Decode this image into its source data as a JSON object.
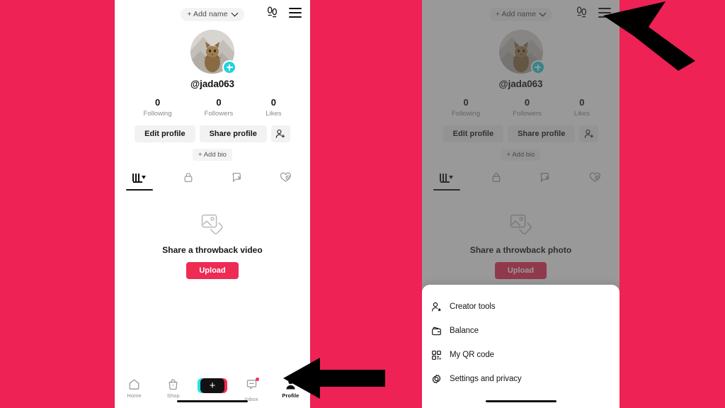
{
  "background_color": "#ee2255",
  "panels": [
    {
      "id": "left",
      "dimmed": false,
      "header": {
        "add_name_label": "+ Add name",
        "chevron_icon": "chevron-down-icon",
        "qa_icon": "footprints-icon",
        "menu_icon": "hamburger-menu-icon"
      },
      "profile": {
        "avatar_icon": "cat-avatar",
        "add_photo_badge": "plus-badge-icon",
        "handle": "@jada063",
        "stats": [
          {
            "value": "0",
            "label": "Following"
          },
          {
            "value": "0",
            "label": "Followers"
          },
          {
            "value": "0",
            "label": "Likes"
          }
        ],
        "edit_profile_label": "Edit profile",
        "share_profile_label": "Share profile",
        "add_friends_icon": "person-add-icon",
        "add_bio_label": "+ Add bio"
      },
      "tabs": [
        {
          "name": "videos",
          "icon": "grid-icon",
          "active": true
        },
        {
          "name": "private",
          "icon": "lock-icon",
          "active": false
        },
        {
          "name": "reposts",
          "icon": "repost-icon",
          "active": false
        },
        {
          "name": "liked",
          "icon": "heart-hidden-icon",
          "active": false
        }
      ],
      "empty_state": {
        "image_icon": "photo-stack-icon",
        "title": "Share a throwback video",
        "upload_label": "Upload",
        "upload_color": "#ee2b55"
      },
      "bottom_nav": [
        {
          "name": "home",
          "icon": "home-icon",
          "label": "Home",
          "active": false
        },
        {
          "name": "shop",
          "icon": "shop-bag-icon",
          "label": "Shop",
          "active": false
        },
        {
          "name": "create",
          "icon": "plus-button-icon",
          "label": "",
          "active": false
        },
        {
          "name": "inbox",
          "icon": "inbox-icon",
          "label": "Inbox",
          "active": false,
          "badge": true
        },
        {
          "name": "profile",
          "icon": "person-icon",
          "label": "Profile",
          "active": true
        }
      ],
      "sheet": null
    },
    {
      "id": "right",
      "dimmed": true,
      "header": {
        "add_name_label": "+ Add name",
        "chevron_icon": "chevron-down-icon",
        "qa_icon": "footprints-icon",
        "menu_icon": "hamburger-menu-icon"
      },
      "profile": {
        "avatar_icon": "cat-avatar",
        "add_photo_badge": "plus-badge-icon",
        "handle": "@jada063",
        "stats": [
          {
            "value": "0",
            "label": "Following"
          },
          {
            "value": "0",
            "label": "Followers"
          },
          {
            "value": "0",
            "label": "Likes"
          }
        ],
        "edit_profile_label": "Edit profile",
        "share_profile_label": "Share profile",
        "add_friends_icon": "person-add-icon",
        "add_bio_label": "+ Add bio"
      },
      "tabs": [
        {
          "name": "videos",
          "icon": "grid-icon",
          "active": true
        },
        {
          "name": "private",
          "icon": "lock-icon",
          "active": false
        },
        {
          "name": "reposts",
          "icon": "repost-icon",
          "active": false
        },
        {
          "name": "liked",
          "icon": "heart-hidden-icon",
          "active": false
        }
      ],
      "empty_state": {
        "image_icon": "photo-stack-icon",
        "title": "Share a throwback photo",
        "upload_label": "Upload",
        "upload_color": "#ee2b55"
      },
      "bottom_nav": null,
      "sheet": {
        "items": [
          {
            "name": "creator-tools",
            "icon": "person-star-icon",
            "label": "Creator tools"
          },
          {
            "name": "balance",
            "icon": "wallet-icon",
            "label": "Balance"
          },
          {
            "name": "my-qr-code",
            "icon": "qr-code-icon",
            "label": "My QR code"
          },
          {
            "name": "settings-and-privacy",
            "icon": "gear-icon",
            "label": "Settings and privacy"
          }
        ]
      }
    }
  ],
  "annotations": [
    {
      "name": "arrow-pointing-to-profile-tab",
      "direction": "left",
      "color": "#000000"
    },
    {
      "name": "arrow-pointing-to-menu-button",
      "direction": "up-left",
      "color": "#000000"
    }
  ]
}
